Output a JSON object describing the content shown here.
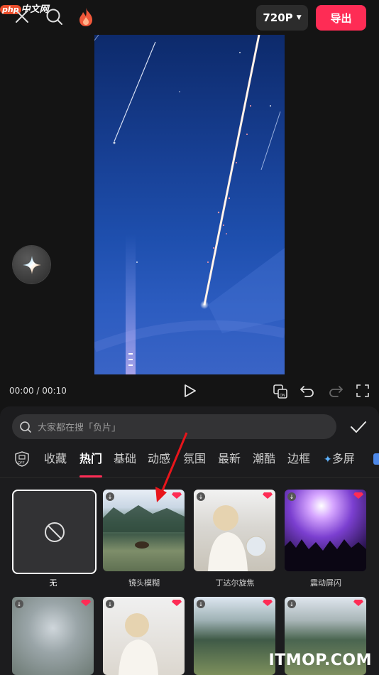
{
  "watermark_top": {
    "badge": "php",
    "text": "中文网"
  },
  "toolbar": {
    "resolution": "720P",
    "export_label": "导出"
  },
  "player": {
    "time": "00:00 / 00:10"
  },
  "search": {
    "placeholder": "大家都在搜「负片」"
  },
  "tabs": [
    {
      "label": "收藏"
    },
    {
      "label": "热门",
      "active": true
    },
    {
      "label": "基础"
    },
    {
      "label": "动感"
    },
    {
      "label": "氛围"
    },
    {
      "label": "最新"
    },
    {
      "label": "潮酷"
    },
    {
      "label": "边框"
    },
    {
      "label": "多屏"
    }
  ],
  "effects_row1": [
    {
      "label": "无"
    },
    {
      "label": "镜头模糊"
    },
    {
      "label": "丁达尔旋焦"
    },
    {
      "label": "震动屏闪"
    }
  ],
  "watermark_bottom": "ITMOP.COM",
  "colors": {
    "accent": "#fe2c55",
    "bg": "#141414",
    "panel": "#1c1c1e"
  }
}
